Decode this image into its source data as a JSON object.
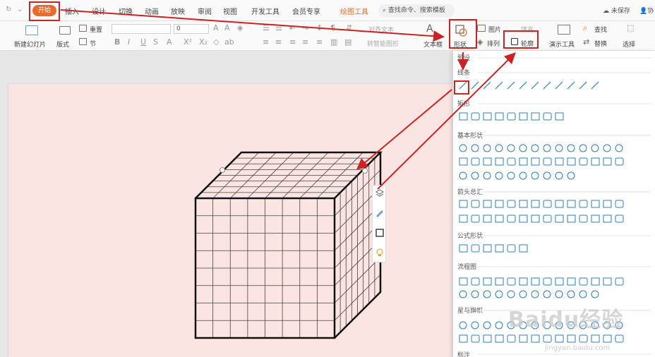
{
  "tabs": {
    "start": "开始",
    "items": [
      "插入",
      "设计",
      "切换",
      "动画",
      "放映",
      "审阅",
      "视图",
      "开发工具",
      "会员专享"
    ],
    "active": "绘图工具",
    "search": "查找命令、搜索模板",
    "unsaved": "未保存",
    "collab": "协"
  },
  "ribbon": {
    "new_slide": "新建幻灯片",
    "layout": "版式",
    "section": "节",
    "reset": "重置",
    "font_size_value": "0",
    "para_textbox": "文本框",
    "text_dir": "对齐文本",
    "smart_shape": "转智能图形",
    "shapes": "形状",
    "picture": "图片",
    "fill": "填充",
    "arrange": "排列",
    "outline": "轮廓",
    "present_tool": "演示工具",
    "find": "查找",
    "replace": "替换",
    "select": "选择"
  },
  "panel": {
    "preset": "预设",
    "lines": "线条",
    "rect": "矩形",
    "basic": "基本形状",
    "arrows": "箭头总汇",
    "formula": "公式形状",
    "flow": "流程图",
    "stars": "星与旗帜",
    "callouts": "标注"
  },
  "watermark": {
    "brand": "Baidu经验",
    "url": "jingyan.baidu.com"
  },
  "colors": {
    "accent": "#e66c2c",
    "annotation": "#cc2222",
    "slide_bg": "#fbe5e3"
  }
}
